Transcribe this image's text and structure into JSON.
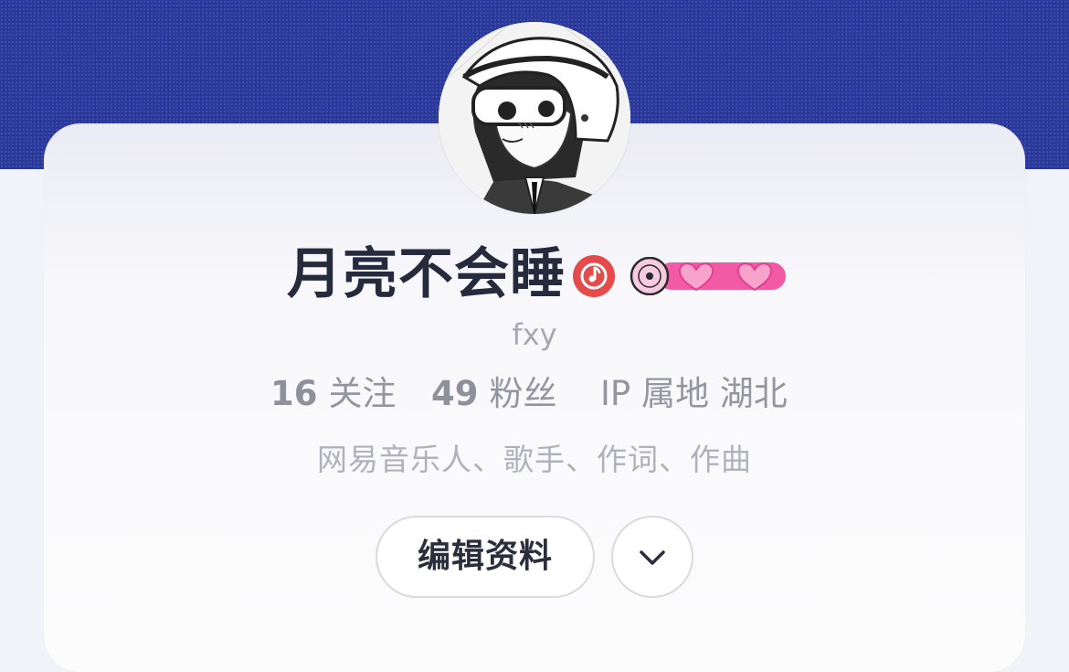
{
  "profile": {
    "name": "月亮不会睡",
    "handle": "fxy",
    "bio": "网易音乐人、歌手、作词、作曲"
  },
  "stats": {
    "following_count": "16",
    "following_label": "关注",
    "fans_count": "49",
    "fans_label": "粉丝",
    "ip_label": "IP 属地",
    "ip_location": "湖北"
  },
  "actions": {
    "edit_label": "编辑资料"
  },
  "icons": {
    "musician_badge": "music-note-icon",
    "vip_badge": "vinyl-hearts-icon",
    "more": "chevron-down-icon"
  },
  "colors": {
    "header_bg": "#2b3a9e",
    "musician_badge": "#e64b4b",
    "vip_pink": "#f25aa6",
    "name_text": "#262a3d",
    "secondary_text": "#93959f"
  }
}
